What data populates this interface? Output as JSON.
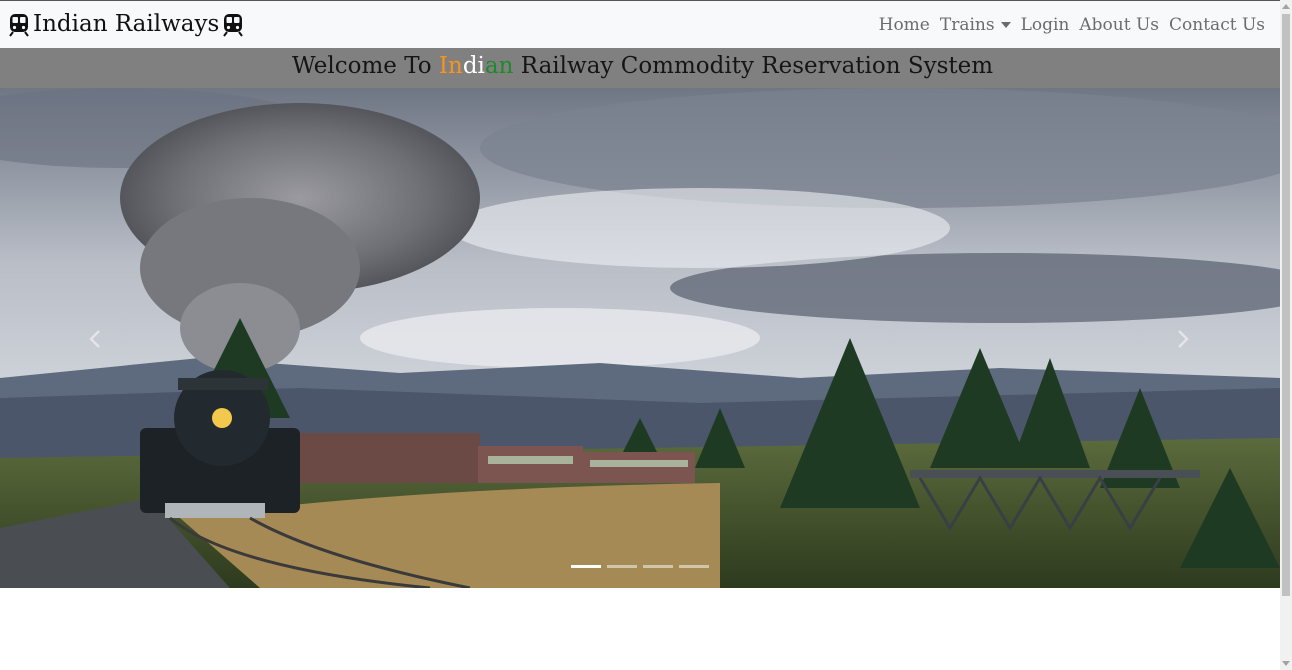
{
  "navbar": {
    "brand_text": "Indian Railways",
    "links": [
      {
        "label": "Home"
      },
      {
        "label": "Trains"
      },
      {
        "label": "Login"
      },
      {
        "label": "About Us"
      },
      {
        "label": "Contact Us"
      }
    ]
  },
  "welcome": {
    "part1": "Welcome To ",
    "in": "In",
    "di": "di",
    "an": "an",
    "part2": " Railway Commodity Reservation System"
  },
  "carousel": {
    "slide_icon": "steam-train-landscape-image",
    "prev_icon": "chevron-left-icon",
    "next_icon": "chevron-right-icon",
    "slide_count": 4,
    "active_slide": 1
  },
  "colors": {
    "navbar_bg": "#f8f9fa",
    "welcome_bg": "#808080",
    "saffron": "#f7941d",
    "white": "#ffffff",
    "green": "#1f8a2a"
  }
}
